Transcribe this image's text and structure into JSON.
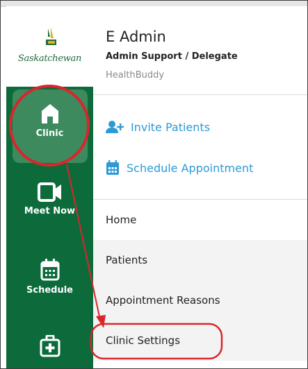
{
  "brand": {
    "logo_text": "Saskatchewan"
  },
  "user": {
    "name": "E Admin",
    "role": "Admin Support / Delegate",
    "app": "HealthBuddy"
  },
  "sidebar": {
    "items": [
      {
        "label": "Clinic",
        "icon": "home-icon",
        "active": true
      },
      {
        "label": "Meet Now",
        "icon": "video-camera-icon"
      },
      {
        "label": "Schedule",
        "icon": "calendar-icon"
      },
      {
        "label": "",
        "icon": "medical-kit-icon"
      }
    ]
  },
  "actions": {
    "invite_label": "Invite Patients",
    "schedule_label": "Schedule Appointment"
  },
  "menu": {
    "items": [
      "Home",
      "Patients",
      "Appointment Reasons",
      "Clinic Settings"
    ]
  },
  "colors": {
    "sidebar_green": "#0d6b3b",
    "active_tile": "#3d8a5f",
    "action_blue": "#2d9ad6",
    "annotation_red": "#d9262c"
  }
}
